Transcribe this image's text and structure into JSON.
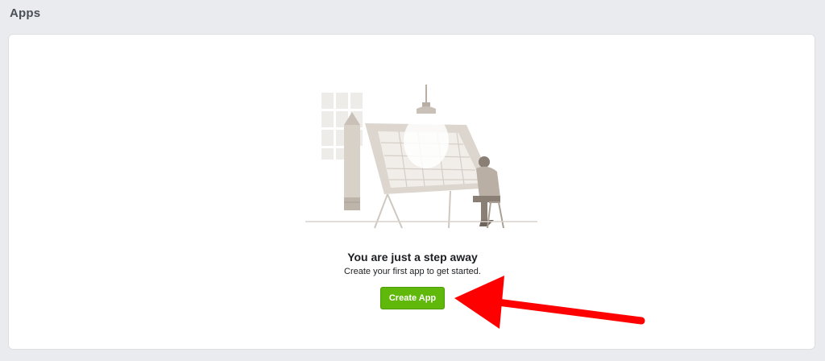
{
  "header": {
    "title": "Apps"
  },
  "empty_state": {
    "title": "You are just a step away",
    "subtitle": "Create your first app to get started.",
    "illustration": "person-at-drafting-table-illustration"
  },
  "actions": {
    "create_app_label": "Create App"
  },
  "colors": {
    "page_background": "#e9ebee",
    "button_green": "#5fb80a",
    "annotation_arrow": "#ff0000"
  }
}
